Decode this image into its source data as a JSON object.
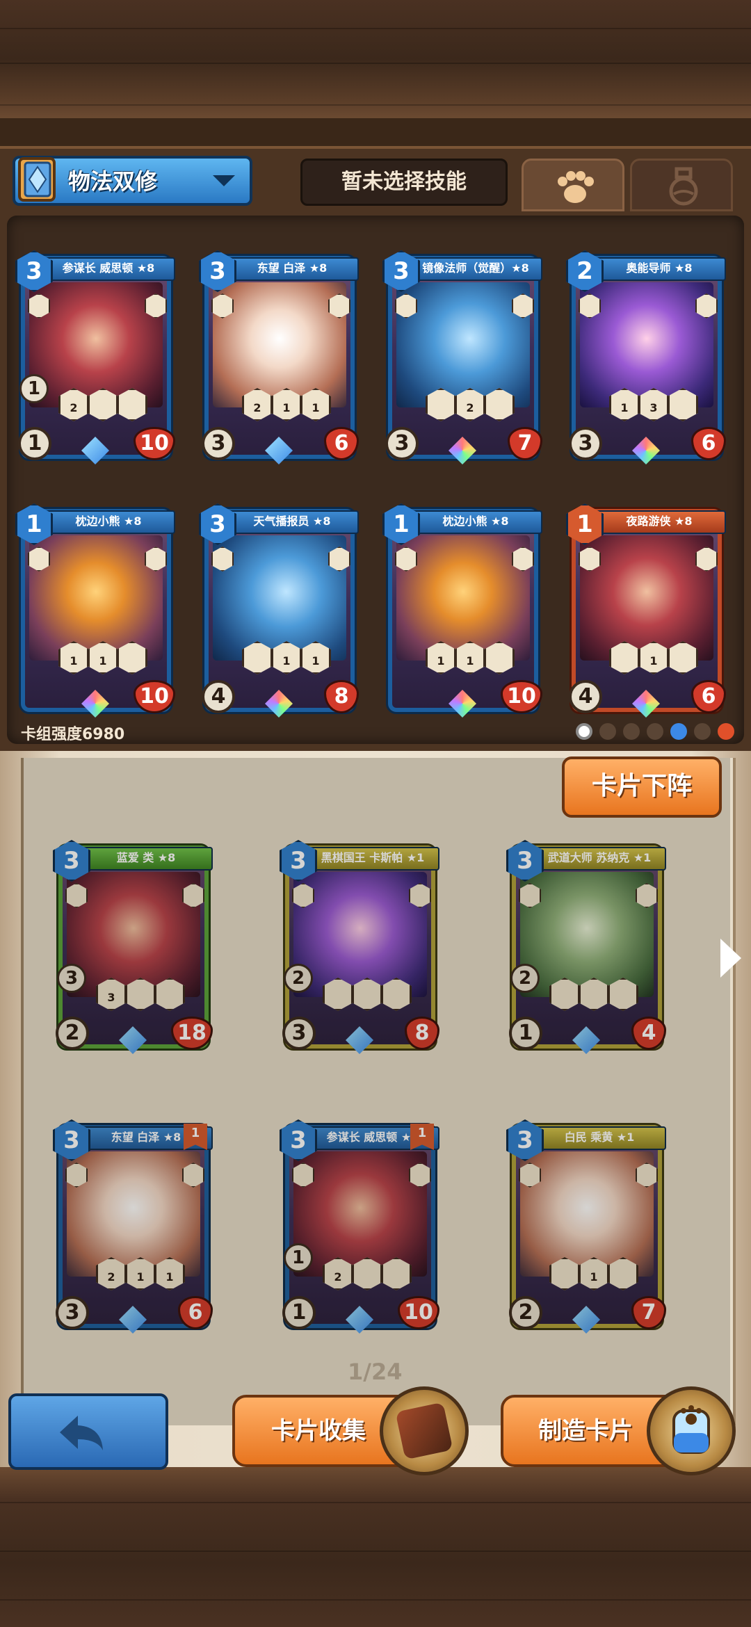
{
  "deck": {
    "name": "物法双修",
    "skill_placeholder": "暂未选择技能",
    "tabs": [
      "paw-icon",
      "potion-icon"
    ],
    "power_label": "卡组强度6980"
  },
  "deck_cards": [
    {
      "name": "参谋长 威思顿 ★8",
      "cost": "3",
      "attack": "1",
      "hp": "10",
      "frame": "blue",
      "art": "red",
      "extra": "1",
      "skills": [
        "2",
        "",
        ""
      ],
      "gem": "star"
    },
    {
      "name": "东望 白泽 ★8",
      "cost": "3",
      "attack": "3",
      "hp": "6",
      "frame": "blue",
      "art": "white",
      "extra": "",
      "skills": [
        "2",
        "1",
        "1"
      ],
      "gem": "star"
    },
    {
      "name": "镜像法师（觉醒）★8",
      "cost": "3",
      "attack": "3",
      "hp": "7",
      "frame": "blue",
      "art": "blue",
      "extra": "",
      "skills": [
        "",
        "2",
        ""
      ],
      "gem": "rainbow"
    },
    {
      "name": "奥能导师 ★8",
      "cost": "2",
      "attack": "3",
      "hp": "6",
      "frame": "blue",
      "art": "purple",
      "extra": "",
      "skills": [
        "1",
        "3",
        ""
      ],
      "gem": "rainbow"
    },
    {
      "name": "枕边小熊 ★8",
      "cost": "1",
      "attack": "",
      "hp": "10",
      "frame": "blue",
      "art": "warm",
      "extra": "",
      "skills": [
        "1",
        "1",
        ""
      ],
      "gem": "rainbow"
    },
    {
      "name": "天气播报员 ★8",
      "cost": "3",
      "attack": "4",
      "hp": "8",
      "frame": "blue",
      "art": "blue",
      "extra": "",
      "skills": [
        "",
        "1",
        "1"
      ],
      "gem": "rainbow"
    },
    {
      "name": "枕边小熊 ★8",
      "cost": "1",
      "attack": "",
      "hp": "10",
      "frame": "blue",
      "art": "warm",
      "extra": "",
      "skills": [
        "1",
        "1",
        ""
      ],
      "gem": "rainbow"
    },
    {
      "name": "夜路游侠 ★8",
      "cost": "1",
      "attack": "4",
      "hp": "6",
      "frame": "orange",
      "art": "red",
      "extra": "",
      "skills": [
        "",
        "1",
        ""
      ],
      "gem": "rainbow"
    }
  ],
  "remove_button": "卡片下阵",
  "collection_cards": [
    {
      "name": "蓝爱 类 ★8",
      "cost": "3",
      "attack": "2",
      "hp": "18",
      "frame": "green",
      "art": "red",
      "extra": "3",
      "skills": [
        "3",
        "",
        ""
      ],
      "flag": ""
    },
    {
      "name": "黑棋国王 卡斯帕 ★1",
      "cost": "3",
      "attack": "3",
      "hp": "8",
      "frame": "gold",
      "art": "purple",
      "extra": "2",
      "skills": [
        "",
        "",
        ""
      ],
      "flag": ""
    },
    {
      "name": "武道大师 苏纳克 ★1",
      "cost": "3",
      "attack": "1",
      "hp": "4",
      "frame": "gold",
      "art": "green",
      "extra": "2",
      "skills": [
        "",
        "",
        ""
      ],
      "flag": ""
    },
    {
      "name": "东望 白泽 ★8",
      "cost": "3",
      "attack": "3",
      "hp": "6",
      "frame": "blue",
      "art": "white",
      "extra": "",
      "skills": [
        "2",
        "1",
        "1"
      ],
      "flag": "1"
    },
    {
      "name": "参谋长 威思顿 ★8",
      "cost": "3",
      "attack": "1",
      "hp": "10",
      "frame": "blue",
      "art": "red",
      "extra": "1",
      "skills": [
        "2",
        "",
        ""
      ],
      "flag": "1"
    },
    {
      "name": "白民 乘黄 ★1",
      "cost": "3",
      "attack": "2",
      "hp": "7",
      "frame": "gold",
      "art": "white",
      "extra": "",
      "skills": [
        "",
        "1",
        ""
      ],
      "flag": ""
    }
  ],
  "pagination": "1/24",
  "buttons": {
    "collect": "卡片收集",
    "craft": "制造卡片"
  },
  "filter_icons": [
    "all-icon",
    "paw-icon",
    "leaf-icon",
    "skull-icon",
    "water-icon",
    "wing-icon",
    "fire-icon"
  ]
}
